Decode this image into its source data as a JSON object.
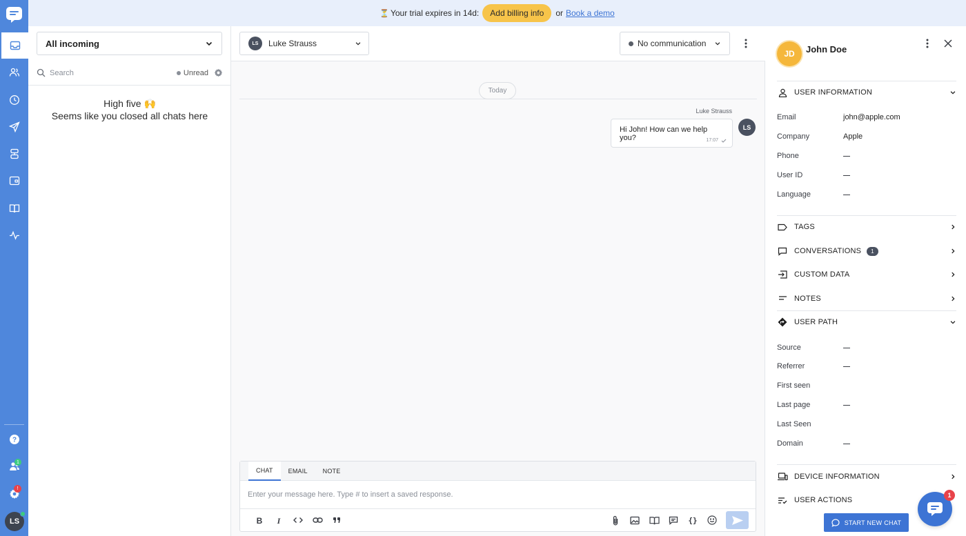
{
  "banner": {
    "trial_text": "Your trial expires in 14d:",
    "billing_label": "Add billing info",
    "or_text": "or",
    "demo_label": "Book a demo"
  },
  "rail": {
    "badges": {
      "contacts": "1",
      "settings": "!"
    },
    "user_initials": "LS"
  },
  "inbox": {
    "filter": "All incoming",
    "search_placeholder": "Search",
    "unread_label": "Unread",
    "empty_title": "High five 🙌",
    "empty_subtitle": "Seems like you closed all chats here"
  },
  "chat": {
    "agent": {
      "initials": "LS",
      "name": "Luke Strauss"
    },
    "status": "No communication",
    "day_label": "Today",
    "messages": [
      {
        "sender": "Luke Strauss",
        "initials": "LS",
        "text": "Hi John! How can we help you?",
        "time": "17:07"
      }
    ],
    "composer": {
      "tabs": [
        "CHAT",
        "EMAIL",
        "NOTE"
      ],
      "placeholder": "Enter your message here. Type # to insert a saved response."
    }
  },
  "profile": {
    "initials": "JD",
    "name": "John Doe",
    "sections": {
      "user_information": "USER INFORMATION",
      "tags": "TAGS",
      "conversations": "CONVERSATIONS",
      "conversations_count": "1",
      "custom_data": "CUSTOM DATA",
      "notes": "NOTES",
      "user_path": "USER PATH",
      "device_information": "DEVICE INFORMATION",
      "user_actions": "USER ACTIONS"
    },
    "user_info": [
      {
        "key": "Email",
        "value": "john@apple.com"
      },
      {
        "key": "Company",
        "value": "Apple"
      },
      {
        "key": "Phone",
        "value": ""
      },
      {
        "key": "User ID",
        "value": ""
      },
      {
        "key": "Language",
        "value": ""
      }
    ],
    "user_path": [
      {
        "key": "Source",
        "value": ""
      },
      {
        "key": "Referrer",
        "value": ""
      },
      {
        "key": "First seen",
        "value": ""
      },
      {
        "key": "Last page",
        "value": ""
      },
      {
        "key": "Last Seen",
        "value": ""
      },
      {
        "key": "Domain",
        "value": ""
      }
    ]
  },
  "start_new_chat_label": "START NEW CHAT",
  "messenger_badge": "1"
}
